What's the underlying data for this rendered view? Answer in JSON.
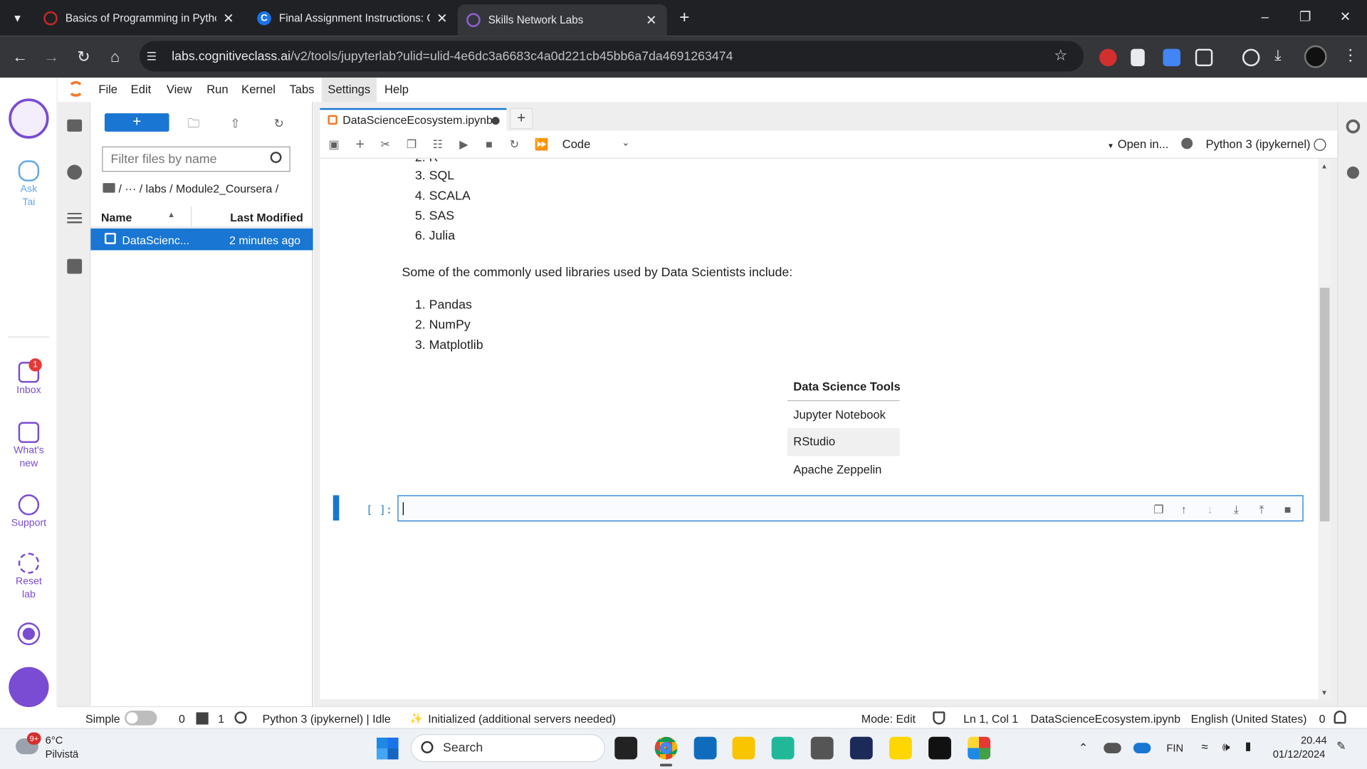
{
  "browser": {
    "tabs": [
      {
        "title": "Basics of Programming in Pytho",
        "color": "#c62828"
      },
      {
        "title": "Final Assignment Instructions: C",
        "color": "#1a73e8"
      },
      {
        "title": "Skills Network Labs",
        "color": "#8a63d2"
      }
    ],
    "url_host": "labs.cognitiveclass.ai",
    "url_path": "/v2/tools/jupyterlab?ulid=ulid-4e6dc3a6683c4a0d221cb45bb6a7da4691263474"
  },
  "tai_sidebar": {
    "ask_tai": "Ask Tai",
    "inbox": "Inbox",
    "inbox_badge": "1",
    "whats_new": "What's new",
    "support": "Support",
    "reset_lab": "Reset lab"
  },
  "menu": [
    "File",
    "Edit",
    "View",
    "Run",
    "Kernel",
    "Tabs",
    "Settings",
    "Help"
  ],
  "file_browser": {
    "new_label": "+",
    "filter_placeholder": "Filter files by name",
    "breadcrumb": "/   ···   / labs / Module2_Coursera /",
    "col_name": "Name",
    "col_modified": "Last Modified",
    "files": [
      {
        "name": "DataScienc...",
        "modified": "2 minutes ago"
      }
    ]
  },
  "notebook": {
    "tab_title": "DataScienceEcosystem.ipynb",
    "cell_type": "Code",
    "open_in": "Open in...",
    "kernel": "Python 3 (ipykernel)",
    "language_items": [
      "3. SQL",
      "4. SCALA",
      "5. SAS",
      "6. Julia"
    ],
    "libraries_intro": "Some of the commonly used libraries used by Data Scientists include:",
    "libraries": [
      "1. Pandas",
      "2. NumPy",
      "3. Matplotlib"
    ],
    "table_header": "Data Science Tools",
    "table_rows": [
      "Jupyter Notebook",
      "RStudio",
      "Apache Zeppelin"
    ],
    "prompt": "[ ]:"
  },
  "statusbar": {
    "simple": "Simple",
    "count0": "0",
    "count1": "1",
    "kernel_status": "Python 3 (ipykernel) | Idle",
    "init": "Initialized (additional servers needed)",
    "mode": "Mode: Edit",
    "position": "Ln 1, Col 1",
    "filename": "DataScienceEcosystem.ipynb",
    "language": "English (United States)",
    "notif": "0"
  },
  "taskbar": {
    "weather_temp": "6°C",
    "weather_desc": "Pilvistä",
    "weather_badge": "9+",
    "search": "Search",
    "lang": "FIN",
    "time": "20.44",
    "date": "01/12/2024"
  }
}
